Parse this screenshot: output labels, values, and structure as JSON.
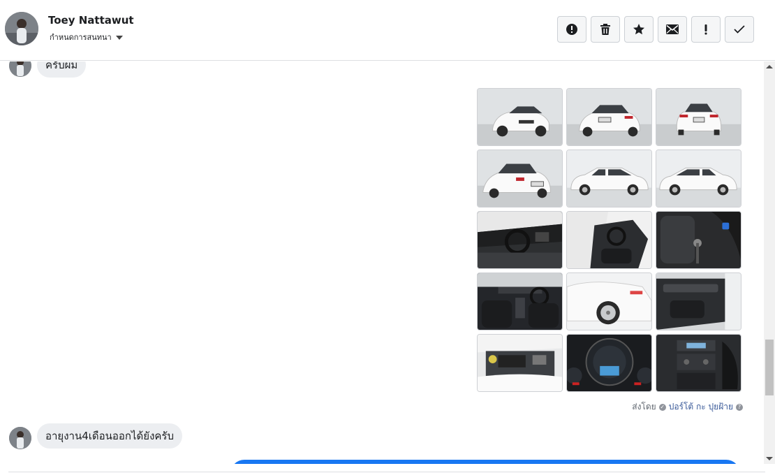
{
  "header": {
    "name": "Toey Nattawut",
    "subtitle": "กำหนดการสนทนา"
  },
  "toolbar": [
    {
      "icon": "alert-circle-icon",
      "name": "mark-spam-button"
    },
    {
      "icon": "trash-icon",
      "name": "delete-button"
    },
    {
      "icon": "star-icon",
      "name": "star-button"
    },
    {
      "icon": "mail-icon",
      "name": "mark-unread-button"
    },
    {
      "icon": "exclamation-icon",
      "name": "follow-up-button"
    },
    {
      "icon": "check-icon",
      "name": "mark-done-button"
    }
  ],
  "messages": {
    "first": "ครับผม",
    "second": "อายุงาน4เดือนออกได้ยังครับ"
  },
  "sent_by": {
    "prefix": "ส่งโดย",
    "who": "ปอร์โต้ กะ ปุยฝ้าย"
  },
  "photos": [
    {
      "name": "car-front-three-quarter-photo",
      "kind": "ext-front"
    },
    {
      "name": "car-rear-three-quarter-photo",
      "kind": "ext-rear"
    },
    {
      "name": "car-rear-photo",
      "kind": "ext-rear"
    },
    {
      "name": "car-rear-angle-photo",
      "kind": "ext-rear"
    },
    {
      "name": "car-side-left-photo",
      "kind": "ext-side"
    },
    {
      "name": "car-side-right-photo",
      "kind": "ext-side"
    },
    {
      "name": "dashboard-photo",
      "kind": "int-dark"
    },
    {
      "name": "seats-photo",
      "kind": "int-dark"
    },
    {
      "name": "gear-shifter-photo",
      "kind": "int-dark"
    },
    {
      "name": "cabin-photo",
      "kind": "int-dark"
    },
    {
      "name": "wheel-photo",
      "kind": "ext-wheel"
    },
    {
      "name": "door-panel-photo",
      "kind": "int-dark"
    },
    {
      "name": "engine-bay-photo",
      "kind": "engine"
    },
    {
      "name": "gauge-cluster-photo",
      "kind": "gauge"
    },
    {
      "name": "center-console-photo",
      "kind": "int-dark"
    }
  ],
  "colors": {
    "accent": "#1877f2",
    "bubble": "#eceef1",
    "link": "#385898"
  }
}
